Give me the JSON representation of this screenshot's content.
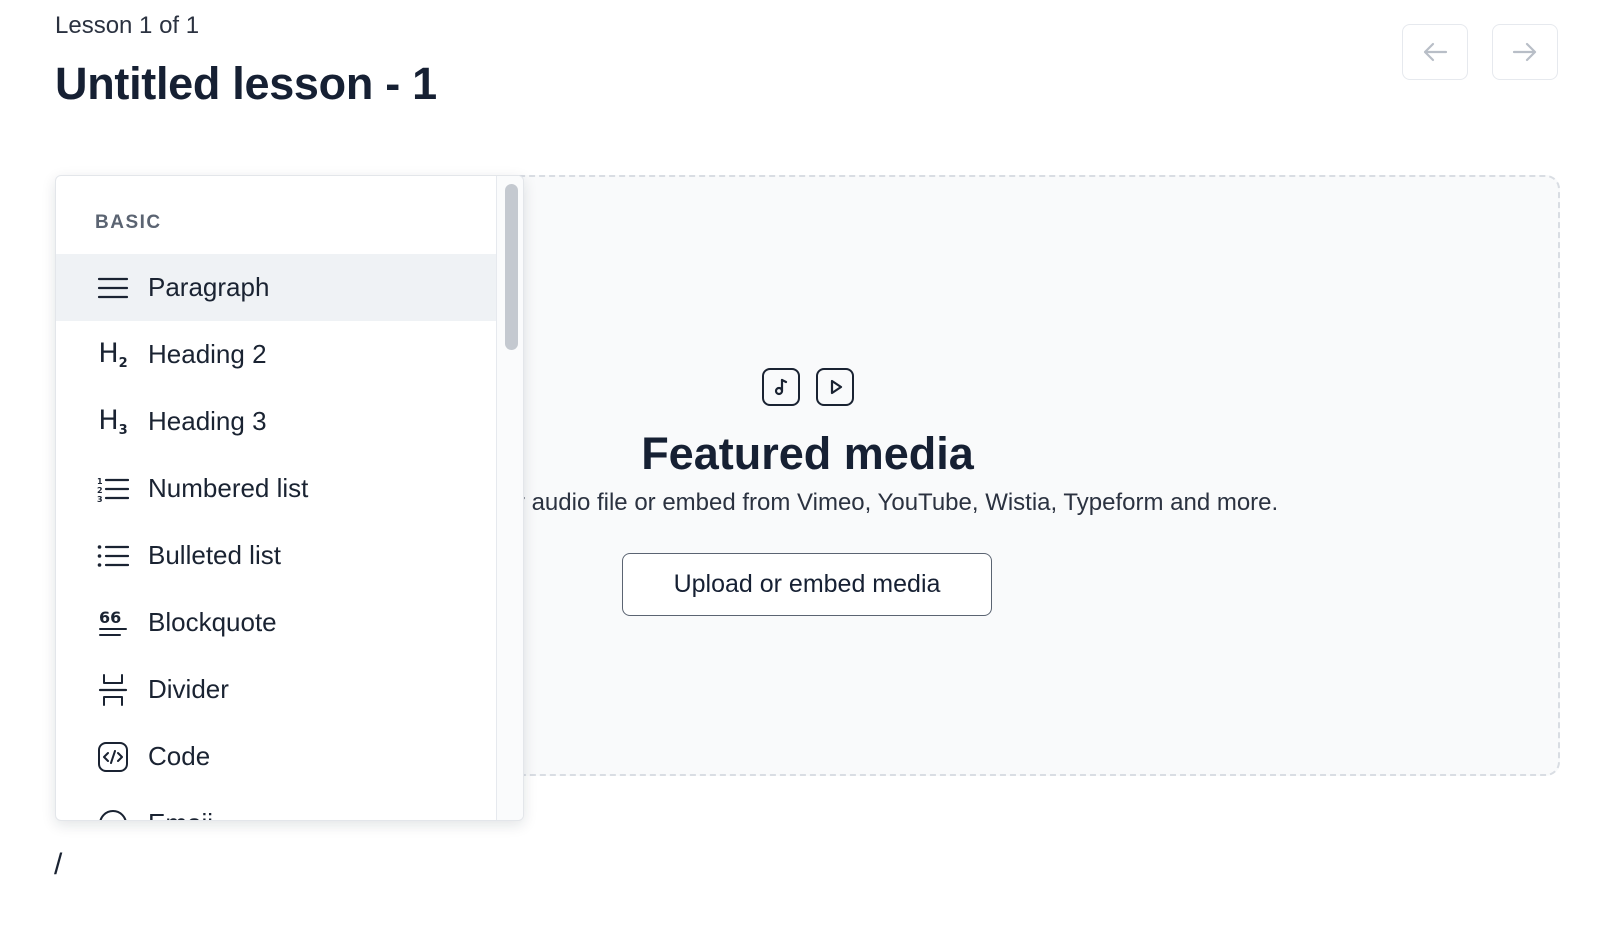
{
  "header": {
    "lesson_counter": "Lesson 1 of 1",
    "title": "Untitled lesson - 1",
    "prev_icon": "arrow-left-icon",
    "next_icon": "arrow-right-icon"
  },
  "featured_media": {
    "icons": [
      "music-note-icon",
      "play-icon"
    ],
    "title": "Featured media",
    "description": "Upload a video or audio file or embed from Vimeo, YouTube, Wistia, Typeform and more.",
    "button_label": "Upload or embed media"
  },
  "slash_menu": {
    "section_label": "BASIC",
    "items": [
      {
        "label": "Paragraph",
        "icon": "paragraph-icon",
        "active": true
      },
      {
        "label": "Heading 2",
        "icon": "heading-2-icon",
        "active": false
      },
      {
        "label": "Heading 3",
        "icon": "heading-3-icon",
        "active": false
      },
      {
        "label": "Numbered list",
        "icon": "numbered-list-icon",
        "active": false
      },
      {
        "label": "Bulleted list",
        "icon": "bulleted-list-icon",
        "active": false
      },
      {
        "label": "Blockquote",
        "icon": "blockquote-icon",
        "active": false
      },
      {
        "label": "Divider",
        "icon": "divider-icon",
        "active": false
      },
      {
        "label": "Code",
        "icon": "code-icon",
        "active": false
      },
      {
        "label": "Emoji",
        "icon": "emoji-icon",
        "active": false
      }
    ]
  },
  "editor": {
    "slash_text": "/"
  },
  "colors": {
    "text": "#1a2332",
    "muted": "#5b6472",
    "active_row": "#eff2f5",
    "dropzone_bg": "#f9fafb"
  }
}
